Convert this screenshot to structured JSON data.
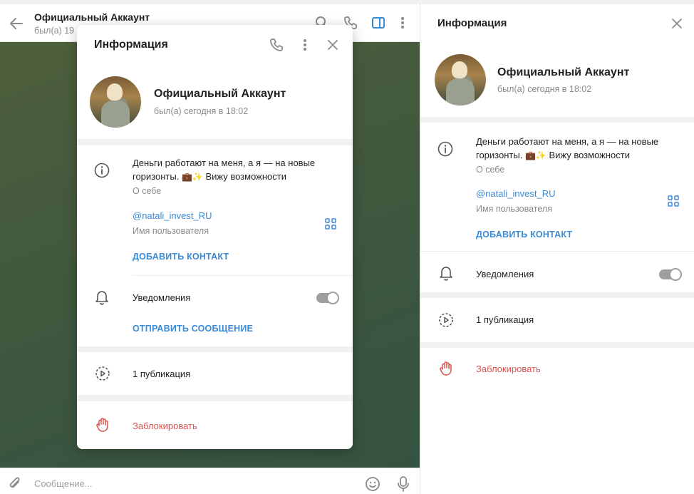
{
  "chat": {
    "title": "Официальный Аккаунт",
    "status": "был(а) 19",
    "composer_placeholder": "Сообщение..."
  },
  "panel": {
    "title": "Информация"
  },
  "profile": {
    "name": "Официальный Аккаунт",
    "status": "был(а) сегодня в 18:02",
    "bio_line1": "Деньги работают на меня, а я — на новые",
    "bio_line2_text1": "горизонты.",
    "bio_line2_emoji": "💼✨",
    "bio_line2_text2": "Вижу возможности",
    "bio_label": "О себе",
    "username": "@natali_invest_RU",
    "username_label": "Имя пользователя",
    "add_contact": "ДОБАВИТЬ КОНТАКТ",
    "notifications": "Уведомления",
    "send_message": "ОТПРАВИТЬ СООБЩЕНИЕ",
    "publications": "1 публикация",
    "block": "Заблокировать"
  },
  "colors": {
    "accent": "#3a8ad6",
    "danger": "#d9534f"
  },
  "icons": [
    "back-arrow-icon",
    "search-icon",
    "phone-icon",
    "sidebar-toggle-icon",
    "more-vertical-icon",
    "close-icon",
    "info-icon",
    "qr-code-icon",
    "bell-icon",
    "story-icon",
    "hand-block-icon",
    "attach-icon",
    "emoji-icon",
    "mic-icon"
  ]
}
